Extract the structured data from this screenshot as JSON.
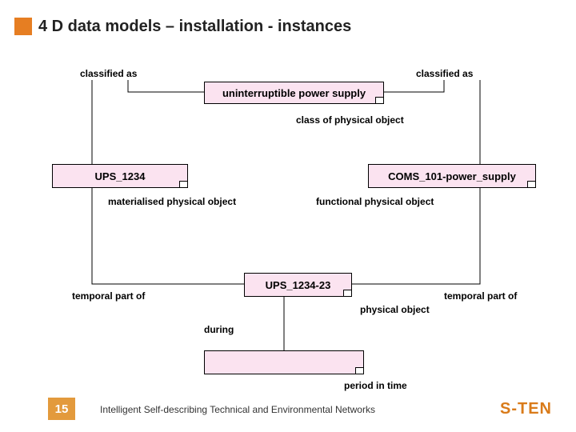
{
  "title": "4 D data models – installation - instances",
  "labels": {
    "classified_left": "classified as",
    "classified_right": "classified as",
    "class_phys": "class of physical object",
    "mat_phys": "materialised physical object",
    "func_phys": "functional physical object",
    "temporal_left": "temporal part of",
    "temporal_right": "temporal part of",
    "phys_obj": "physical object",
    "during": "during",
    "period": "period in time"
  },
  "boxes": {
    "uninterruptible": "uninterruptible power supply",
    "ups1234": "UPS_1234",
    "coms": "COMS_101-power_supply",
    "ups1234_23": "UPS_1234-23",
    "blank": ""
  },
  "footer": {
    "page": "15",
    "text": "Intelligent Self-describing Technical and Environmental Networks",
    "brand": "S-TEN"
  }
}
